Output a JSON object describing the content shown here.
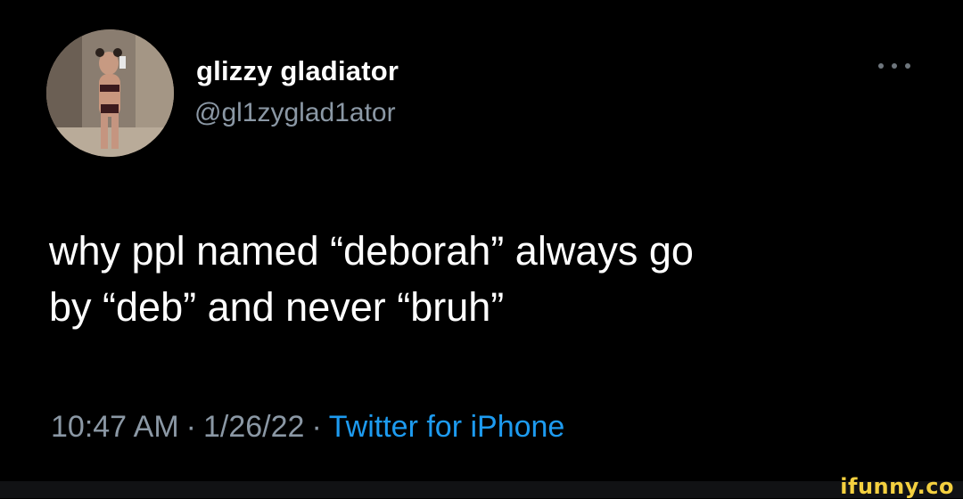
{
  "author": {
    "display_name": "glizzy gladiator",
    "handle": "@gl1zyglad1ator"
  },
  "tweet": {
    "text": "why ppl named “deborah” always go\nby “deb” and never “bruh”",
    "time": "10:47 AM",
    "date": "1/26/22",
    "source": "Twitter for iPhone",
    "separator": "·"
  },
  "watermark": "ifunny.co",
  "colors": {
    "background": "#000000",
    "primary_text": "#ffffff",
    "secondary_text": "#8b98a5",
    "link": "#1d9bf0",
    "watermark": "#f4d03f"
  },
  "icons": {
    "more": "more-options-icon"
  }
}
